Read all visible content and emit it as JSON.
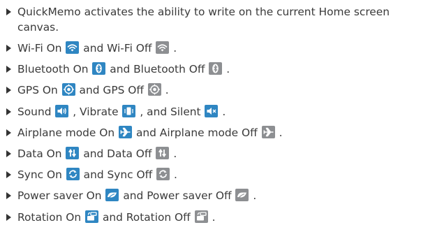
{
  "items": [
    {
      "text": "QuickMemo activates the ability to write on the current Home screen canvas."
    },
    {
      "a": "Wi-Fi On ",
      "b": " and Wi-Fi Off ",
      "c": "."
    },
    {
      "a": "Bluetooth On ",
      "b": " and Bluetooth Off ",
      "c": "."
    },
    {
      "a": "GPS On ",
      "b": " and GPS Off ",
      "c": "."
    },
    {
      "a": "Sound ",
      "b": ", Vibrate ",
      "c": ", and Silent ",
      "d": "."
    },
    {
      "a": "Airplane mode On ",
      "b": " and Airplane mode Off ",
      "c": "."
    },
    {
      "a": "Data On ",
      "b": " and Data Off ",
      "c": "."
    },
    {
      "a": "Sync On ",
      "b": " and Sync Off ",
      "c": "."
    },
    {
      "a": "Power saver On ",
      "b": " and Power saver Off ",
      "c": "."
    },
    {
      "a": "Rotation On ",
      "b": " and Rotation Off ",
      "c": "."
    }
  ],
  "icons": {
    "wifi_on": "wifi-icon",
    "wifi_off": "wifi-icon",
    "bluetooth_on": "bluetooth-icon",
    "bluetooth_off": "bluetooth-icon",
    "gps_on": "gps-icon",
    "gps_off": "gps-icon",
    "sound": "speaker-icon",
    "vibrate": "vibrate-icon",
    "silent": "muted-speaker-icon",
    "airplane_on": "airplane-icon",
    "airplane_off": "airplane-icon",
    "data_on": "data-arrows-icon",
    "data_off": "data-arrows-icon",
    "sync_on": "sync-icon",
    "sync_off": "sync-icon",
    "power_saver_on": "power-saver-icon",
    "power_saver_off": "power-saver-icon",
    "rotation_on": "rotation-icon",
    "rotation_off": "rotation-icon"
  },
  "colors": {
    "text": "#3a3a3a",
    "bullet": "#333333",
    "icon_on": "#2f86c2",
    "icon_off": "#8d8f92"
  }
}
